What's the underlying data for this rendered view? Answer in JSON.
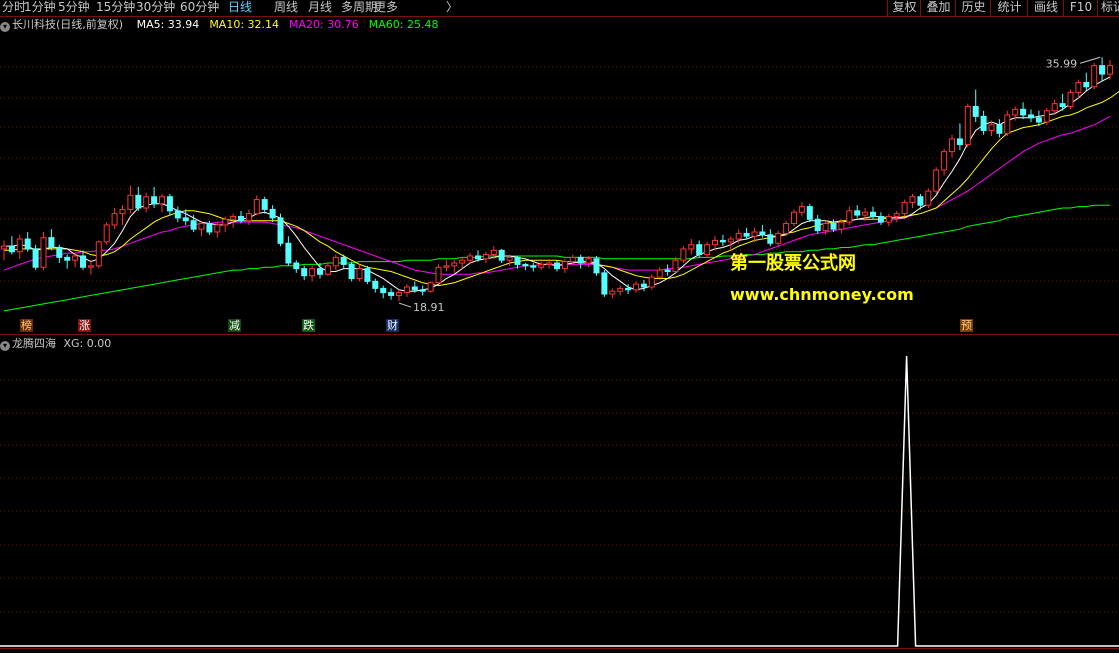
{
  "toolbar": {
    "tabs": [
      {
        "label": "分时",
        "active": false
      },
      {
        "label": "1分钟",
        "active": false
      },
      {
        "label": "5分钟",
        "active": false
      },
      {
        "label": "15分钟",
        "active": false
      },
      {
        "label": "30分钟",
        "active": false
      },
      {
        "label": "60分钟",
        "active": false
      },
      {
        "label": "日线",
        "active": true
      },
      {
        "label": "周线",
        "active": false
      },
      {
        "label": "月线",
        "active": false
      },
      {
        "label": "多周期",
        "active": false
      },
      {
        "label": "更多",
        "active": false
      }
    ],
    "more_arrow": "〉",
    "right_tabs": [
      "复权",
      "叠加",
      "历史",
      "统计",
      "画线",
      "F10",
      "标记"
    ]
  },
  "stock_title": "长川科技(日线,前复权)",
  "ma_labels": [
    {
      "label": "MA5: 33.94",
      "color": "#ffffff"
    },
    {
      "label": "MA10: 32.14",
      "color": "#ffff00"
    },
    {
      "label": "MA20: 30.76",
      "color": "#ff00ff"
    },
    {
      "label": "MA60: 25.48",
      "color": "#00ff00"
    }
  ],
  "indicator_title": "龙腾四海",
  "indicator_value": "XG: 0.00",
  "price_annotations": {
    "high": "35.99",
    "low": "18.91"
  },
  "signals": [
    {
      "text": "榜",
      "bg": "#6a2a0a",
      "color": "#ffd080"
    },
    {
      "text": "涨",
      "bg": "#8a1010",
      "color": "#ffffff"
    },
    {
      "text": "减",
      "bg": "#104a10",
      "color": "#ffffff"
    },
    {
      "text": "跌",
      "bg": "#0f5a0f",
      "color": "#ffffff"
    },
    {
      "text": "财",
      "bg": "#102a6a",
      "color": "#ffffff"
    },
    {
      "text": "预",
      "bg": "#7a3a0a",
      "color": "#ffd080"
    }
  ],
  "watermark": {
    "line1": "第一股票公式网",
    "line2": "www.chnmoney.com"
  },
  "colors": {
    "up": "#ff3232",
    "down": "#54ffff",
    "ma5": "#ffffff",
    "ma10": "#ffff00",
    "ma20": "#ff00ff",
    "ma60": "#00ff00",
    "grid": "#7a1010",
    "indicator": "#ffffff"
  },
  "chart_data": {
    "type": "candlestick",
    "ylim": [
      17.5,
      37.5
    ],
    "candles": [
      [
        22.4,
        23.0,
        21.6,
        22.6
      ],
      [
        22.6,
        23.3,
        22.0,
        22.2
      ],
      [
        22.2,
        23.4,
        21.7,
        23.1
      ],
      [
        23.1,
        23.6,
        22.2,
        22.4
      ],
      [
        22.4,
        22.7,
        20.9,
        21.1
      ],
      [
        21.1,
        23.6,
        20.9,
        23.2
      ],
      [
        23.2,
        23.8,
        22.3,
        22.5
      ],
      [
        22.5,
        22.7,
        21.4,
        21.8
      ],
      [
        21.8,
        22.0,
        21.0,
        21.6
      ],
      [
        21.6,
        22.1,
        21.1,
        21.9
      ],
      [
        21.9,
        22.3,
        20.9,
        21.1
      ],
      [
        21.1,
        21.6,
        20.6,
        21.2
      ],
      [
        21.2,
        23.0,
        21.0,
        22.9
      ],
      [
        22.9,
        24.3,
        22.7,
        24.1
      ],
      [
        24.1,
        25.3,
        23.8,
        24.9
      ],
      [
        24.9,
        25.5,
        24.1,
        25.2
      ],
      [
        25.2,
        26.9,
        24.9,
        26.2
      ],
      [
        26.2,
        26.8,
        25.1,
        25.3
      ],
      [
        25.3,
        26.4,
        25.0,
        26.1
      ],
      [
        26.1,
        26.8,
        25.3,
        25.6
      ],
      [
        25.6,
        26.3,
        25.0,
        26.1
      ],
      [
        26.1,
        26.3,
        24.8,
        25.1
      ],
      [
        25.1,
        25.4,
        24.3,
        24.6
      ],
      [
        24.6,
        25.2,
        24.1,
        24.4
      ],
      [
        24.4,
        24.8,
        23.6,
        23.8
      ],
      [
        23.8,
        24.4,
        23.3,
        24.2
      ],
      [
        24.2,
        24.4,
        23.4,
        23.6
      ],
      [
        23.6,
        24.3,
        23.2,
        24.1
      ],
      [
        24.1,
        24.7,
        23.6,
        24.5
      ],
      [
        24.5,
        24.9,
        23.9,
        24.7
      ],
      [
        24.7,
        25.1,
        24.2,
        24.4
      ],
      [
        24.4,
        25.2,
        24.1,
        24.9
      ],
      [
        24.9,
        26.2,
        24.8,
        25.9
      ],
      [
        25.9,
        26.1,
        24.9,
        25.2
      ],
      [
        25.2,
        25.5,
        24.3,
        24.6
      ],
      [
        24.6,
        24.9,
        22.6,
        22.8
      ],
      [
        22.8,
        23.3,
        21.2,
        21.4
      ],
      [
        21.4,
        21.6,
        20.7,
        21.0
      ],
      [
        21.0,
        21.2,
        20.2,
        20.5
      ],
      [
        20.5,
        21.2,
        20.1,
        21.0
      ],
      [
        21.0,
        21.4,
        20.3,
        20.6
      ],
      [
        20.6,
        21.4,
        20.5,
        21.2
      ],
      [
        21.2,
        22.0,
        20.9,
        21.8
      ],
      [
        21.8,
        22.0,
        21.0,
        21.3
      ],
      [
        21.3,
        21.5,
        20.1,
        20.3
      ],
      [
        20.3,
        21.3,
        20.1,
        21.0
      ],
      [
        21.0,
        21.2,
        19.9,
        20.1
      ],
      [
        20.1,
        20.3,
        19.3,
        19.6
      ],
      [
        19.6,
        19.8,
        18.9,
        19.3
      ],
      [
        19.3,
        19.6,
        18.8,
        19.1
      ],
      [
        19.1,
        19.5,
        18.7,
        19.3
      ],
      [
        19.3,
        19.9,
        19.0,
        19.7
      ],
      [
        19.7,
        20.1,
        19.3,
        19.5
      ],
      [
        19.5,
        19.8,
        19.1,
        19.4
      ],
      [
        19.4,
        20.1,
        19.3,
        20.0
      ],
      [
        20.0,
        21.3,
        19.9,
        21.1
      ],
      [
        21.1,
        21.6,
        20.8,
        21.2
      ],
      [
        21.2,
        21.6,
        20.7,
        21.4
      ],
      [
        21.4,
        21.8,
        21.0,
        21.6
      ],
      [
        21.6,
        22.1,
        21.3,
        21.9
      ],
      [
        21.9,
        22.3,
        21.5,
        21.7
      ],
      [
        21.7,
        22.2,
        21.4,
        22.0
      ],
      [
        22.0,
        22.6,
        21.7,
        22.3
      ],
      [
        22.3,
        22.4,
        21.4,
        21.6
      ],
      [
        21.6,
        22.0,
        21.2,
        21.8
      ],
      [
        21.8,
        21.9,
        21.0,
        21.3
      ],
      [
        21.3,
        21.4,
        20.9,
        21.2
      ],
      [
        21.2,
        21.4,
        20.8,
        21.1
      ],
      [
        21.1,
        21.5,
        20.9,
        21.3
      ],
      [
        21.3,
        21.7,
        21.0,
        21.4
      ],
      [
        21.4,
        21.6,
        20.8,
        21.0
      ],
      [
        21.0,
        21.7,
        20.7,
        21.5
      ],
      [
        21.5,
        22.0,
        21.3,
        21.8
      ],
      [
        21.8,
        22.0,
        21.0,
        21.4
      ],
      [
        21.4,
        21.9,
        21.1,
        21.7
      ],
      [
        21.7,
        21.9,
        20.5,
        20.7
      ],
      [
        20.7,
        20.9,
        19.0,
        19.2
      ],
      [
        19.2,
        19.6,
        18.9,
        19.4
      ],
      [
        19.4,
        19.8,
        19.1,
        19.6
      ],
      [
        19.6,
        19.9,
        19.2,
        19.5
      ],
      [
        19.5,
        20.1,
        19.3,
        19.9
      ],
      [
        19.9,
        20.2,
        19.4,
        19.7
      ],
      [
        19.7,
        20.6,
        19.5,
        20.4
      ],
      [
        20.4,
        21.1,
        20.2,
        20.9
      ],
      [
        20.9,
        21.3,
        20.5,
        20.8
      ],
      [
        20.8,
        21.8,
        20.7,
        21.6
      ],
      [
        21.6,
        22.6,
        21.4,
        22.4
      ],
      [
        22.4,
        23.1,
        22.0,
        22.7
      ],
      [
        22.7,
        23.0,
        21.8,
        22.0
      ],
      [
        22.0,
        22.9,
        21.8,
        22.7
      ],
      [
        22.7,
        23.3,
        22.3,
        23.0
      ],
      [
        23.0,
        23.4,
        22.6,
        22.9
      ],
      [
        22.9,
        23.3,
        22.3,
        23.1
      ],
      [
        23.1,
        23.8,
        22.8,
        23.5
      ],
      [
        23.5,
        23.9,
        23.1,
        23.3
      ],
      [
        23.3,
        23.9,
        22.9,
        23.6
      ],
      [
        23.6,
        24.1,
        23.2,
        23.4
      ],
      [
        23.4,
        23.8,
        22.6,
        22.8
      ],
      [
        22.8,
        23.7,
        22.6,
        23.5
      ],
      [
        23.5,
        24.4,
        23.3,
        24.2
      ],
      [
        24.2,
        25.2,
        24.0,
        25.0
      ],
      [
        25.0,
        25.7,
        24.7,
        25.4
      ],
      [
        25.4,
        25.6,
        24.3,
        24.5
      ],
      [
        24.5,
        24.8,
        23.5,
        23.7
      ],
      [
        23.7,
        24.4,
        23.4,
        24.2
      ],
      [
        24.2,
        24.5,
        23.6,
        23.8
      ],
      [
        23.8,
        24.5,
        23.5,
        24.3
      ],
      [
        24.3,
        25.4,
        24.1,
        25.1
      ],
      [
        25.1,
        25.5,
        24.6,
        24.8
      ],
      [
        24.8,
        25.3,
        24.4,
        25.0
      ],
      [
        25.0,
        25.4,
        24.5,
        24.7
      ],
      [
        24.7,
        25.0,
        24.1,
        24.3
      ],
      [
        24.3,
        24.9,
        24.0,
        24.7
      ],
      [
        24.7,
        25.1,
        24.3,
        24.9
      ],
      [
        24.9,
        25.9,
        24.7,
        25.7
      ],
      [
        25.7,
        26.3,
        25.3,
        26.1
      ],
      [
        26.1,
        26.3,
        25.2,
        25.5
      ],
      [
        25.5,
        26.7,
        25.3,
        26.5
      ],
      [
        26.5,
        28.2,
        26.3,
        28.0
      ],
      [
        28.0,
        29.5,
        27.6,
        29.3
      ],
      [
        29.3,
        30.5,
        28.9,
        30.2
      ],
      [
        30.2,
        31.3,
        29.4,
        29.8
      ],
      [
        29.8,
        32.7,
        29.6,
        32.5
      ],
      [
        32.5,
        33.7,
        31.4,
        31.8
      ],
      [
        31.8,
        32.2,
        30.5,
        30.8
      ],
      [
        30.8,
        31.5,
        30.4,
        31.2
      ],
      [
        31.2,
        31.6,
        30.3,
        30.6
      ],
      [
        30.6,
        32.2,
        30.4,
        31.9
      ],
      [
        31.9,
        32.5,
        31.5,
        32.3
      ],
      [
        32.3,
        32.8,
        31.6,
        31.9
      ],
      [
        31.9,
        32.3,
        31.4,
        31.7
      ],
      [
        31.7,
        32.2,
        31.1,
        31.4
      ],
      [
        31.4,
        32.4,
        31.2,
        32.2
      ],
      [
        32.2,
        33.0,
        31.9,
        32.7
      ],
      [
        32.7,
        33.4,
        32.2,
        32.5
      ],
      [
        32.5,
        33.7,
        32.3,
        33.5
      ],
      [
        33.5,
        34.4,
        33.1,
        34.2
      ],
      [
        34.2,
        34.9,
        33.6,
        33.9
      ],
      [
        33.9,
        35.6,
        33.7,
        35.4
      ],
      [
        35.4,
        35.99,
        34.3,
        34.8
      ],
      [
        34.8,
        35.8,
        34.4,
        35.4
      ]
    ],
    "ma5": [
      22.6,
      22.6,
      22.7,
      22.6,
      22.3,
      22.4,
      22.5,
      22.5,
      22.4,
      22.0,
      21.8,
      21.5,
      21.7,
      22.2,
      22.8,
      23.7,
      24.7,
      25.3,
      25.5,
      25.6,
      25.6,
      25.4,
      25.1,
      24.9,
      24.6,
      24.3,
      24.2,
      24.1,
      24.1,
      24.3,
      24.5,
      24.6,
      24.9,
      25.0,
      24.8,
      24.6,
      24.0,
      23.3,
      22.5,
      21.8,
      21.1,
      20.8,
      20.8,
      21.0,
      21.0,
      21.0,
      20.9,
      20.6,
      20.3,
      19.9,
      19.5,
      19.4,
      19.4,
      19.5,
      19.6,
      19.9,
      20.3,
      20.6,
      21.0,
      21.4,
      21.6,
      21.7,
      21.8,
      21.9,
      21.9,
      21.8,
      21.7,
      21.5,
      21.3,
      21.3,
      21.2,
      21.3,
      21.4,
      21.5,
      21.5,
      21.4,
      21.0,
      20.5,
      20.1,
      19.7,
      19.5,
      19.6,
      19.8,
      20.0,
      20.3,
      20.7,
      21.2,
      21.7,
      22.0,
      22.2,
      22.4,
      22.5,
      22.7,
      23.0,
      23.1,
      23.3,
      23.4,
      23.3,
      23.3,
      23.4,
      23.8,
      24.2,
      24.4,
      24.4,
      24.4,
      24.3,
      24.3,
      24.4,
      24.5,
      24.6,
      24.7,
      24.7,
      24.6,
      24.6,
      24.6,
      24.9,
      25.3,
      25.6,
      26.2,
      27.1,
      27.9,
      28.8,
      29.9,
      30.8,
      31.2,
      31.4,
      31.2,
      31.5,
      31.7,
      31.7,
      31.7,
      31.8,
      31.9,
      32.0,
      32.3,
      32.7,
      33.1,
      33.6,
      34.0,
      34.3,
      34.6
    ],
    "ma10": [
      22.3,
      22.3,
      22.4,
      22.4,
      22.4,
      22.4,
      22.4,
      22.4,
      22.4,
      22.3,
      22.2,
      22.0,
      21.9,
      22.0,
      22.2,
      22.6,
      23.1,
      23.5,
      23.9,
      24.3,
      24.6,
      24.8,
      25.0,
      25.1,
      25.1,
      25.0,
      24.9,
      24.7,
      24.5,
      24.4,
      24.4,
      24.4,
      24.4,
      24.4,
      24.4,
      24.4,
      24.2,
      24.0,
      23.7,
      23.3,
      22.9,
      22.6,
      22.2,
      21.9,
      21.6,
      21.3,
      21.1,
      21.0,
      20.9,
      20.8,
      20.6,
      20.4,
      20.2,
      20.0,
      19.9,
      19.8,
      19.9,
      20.0,
      20.2,
      20.4,
      20.6,
      20.8,
      21.0,
      21.2,
      21.4,
      21.5,
      21.6,
      21.6,
      21.6,
      21.6,
      21.6,
      21.5,
      21.5,
      21.4,
      21.4,
      21.3,
      21.2,
      21.1,
      20.9,
      20.7,
      20.5,
      20.4,
      20.3,
      20.3,
      20.3,
      20.4,
      20.6,
      20.9,
      21.2,
      21.5,
      21.8,
      22.1,
      22.3,
      22.6,
      22.8,
      23.0,
      23.1,
      23.2,
      23.3,
      23.5,
      23.6,
      23.8,
      23.9,
      24.1,
      24.2,
      24.3,
      24.4,
      24.4,
      24.5,
      24.5,
      24.5,
      24.5,
      24.6,
      24.6,
      24.7,
      24.8,
      24.9,
      25.1,
      25.3,
      25.8,
      26.3,
      26.8,
      27.4,
      28.1,
      28.8,
      29.5,
      30.1,
      30.6,
      30.8,
      31.0,
      31.1,
      31.2,
      31.4,
      31.6,
      31.8,
      31.9,
      32.1,
      32.4,
      32.6,
      32.8,
      33.1,
      33.5,
      33.9
    ],
    "ma20": [
      20.9,
      21.1,
      21.3,
      21.5,
      21.7,
      21.8,
      21.9,
      22.0,
      22.1,
      22.1,
      22.2,
      22.2,
      22.3,
      22.3,
      22.4,
      22.6,
      22.8,
      23.0,
      23.2,
      23.4,
      23.6,
      23.7,
      23.9,
      24.0,
      24.1,
      24.2,
      24.2,
      24.3,
      24.3,
      24.3,
      24.3,
      24.3,
      24.3,
      24.3,
      24.2,
      24.1,
      24.0,
      23.9,
      23.7,
      23.5,
      23.3,
      23.1,
      22.9,
      22.7,
      22.5,
      22.3,
      22.1,
      21.9,
      21.7,
      21.5,
      21.3,
      21.1,
      20.9,
      20.8,
      20.7,
      20.6,
      20.6,
      20.6,
      20.6,
      20.6,
      20.7,
      20.7,
      20.8,
      20.9,
      21.0,
      21.1,
      21.2,
      21.2,
      21.3,
      21.3,
      21.3,
      21.3,
      21.3,
      21.3,
      21.3,
      21.3,
      21.2,
      21.1,
      21.0,
      20.9,
      20.9,
      20.9,
      20.9,
      20.9,
      21.0,
      21.0,
      21.1,
      21.2,
      21.3,
      21.4,
      21.5,
      21.6,
      21.7,
      21.8,
      21.9,
      22.0,
      22.2,
      22.4,
      22.6,
      22.8,
      23.0,
      23.2,
      23.4,
      23.5,
      23.6,
      23.7,
      23.8,
      23.9,
      24.0,
      24.1,
      24.2,
      24.3,
      24.4,
      24.5,
      24.6,
      24.8,
      24.9,
      25.1,
      25.3,
      25.6,
      25.9,
      26.2,
      26.5,
      26.9,
      27.3,
      27.7,
      28.1,
      28.5,
      28.9,
      29.3,
      29.6,
      29.9,
      30.1,
      30.3,
      30.5,
      30.6,
      30.8,
      31.0,
      31.2,
      31.5,
      31.8
    ],
    "ma60": [
      18.0,
      18.1,
      18.2,
      18.3,
      18.4,
      18.5,
      18.6,
      18.7,
      18.8,
      18.9,
      19.0,
      19.1,
      19.2,
      19.3,
      19.4,
      19.5,
      19.6,
      19.7,
      19.8,
      19.9,
      20.0,
      20.1,
      20.2,
      20.3,
      20.4,
      20.5,
      20.6,
      20.7,
      20.8,
      20.9,
      20.9,
      21.0,
      21.0,
      21.1,
      21.1,
      21.2,
      21.2,
      21.2,
      21.3,
      21.3,
      21.3,
      21.4,
      21.4,
      21.4,
      21.4,
      21.5,
      21.5,
      21.5,
      21.5,
      21.5,
      21.5,
      21.6,
      21.6,
      21.6,
      21.6,
      21.7,
      21.7,
      21.7,
      21.8,
      21.8,
      21.8,
      21.9,
      21.9,
      21.9,
      21.9,
      21.9,
      21.9,
      21.9,
      21.9,
      21.9,
      21.9,
      21.8,
      21.8,
      21.8,
      21.8,
      21.8,
      21.7,
      21.7,
      21.7,
      21.7,
      21.7,
      21.7,
      21.7,
      21.7,
      21.7,
      21.7,
      21.7,
      21.7,
      21.8,
      21.8,
      21.8,
      21.9,
      21.9,
      21.9,
      22.0,
      22.0,
      22.0,
      22.1,
      22.1,
      22.2,
      22.2,
      22.2,
      22.3,
      22.3,
      22.4,
      22.4,
      22.5,
      22.5,
      22.6,
      22.7,
      22.7,
      22.8,
      22.9,
      23.0,
      23.1,
      23.2,
      23.3,
      23.4,
      23.5,
      23.6,
      23.7,
      23.8,
      24.0,
      24.1,
      24.2,
      24.3,
      24.4,
      24.6,
      24.7,
      24.8,
      24.9,
      25.0,
      25.1,
      25.2,
      25.3,
      25.3,
      25.4,
      25.4,
      25.5,
      25.5,
      25.5
    ],
    "xg_signal": {
      "total_bars": 141,
      "spike_bar": 114,
      "value": 1
    },
    "ylabel": "",
    "xlabel": ""
  }
}
